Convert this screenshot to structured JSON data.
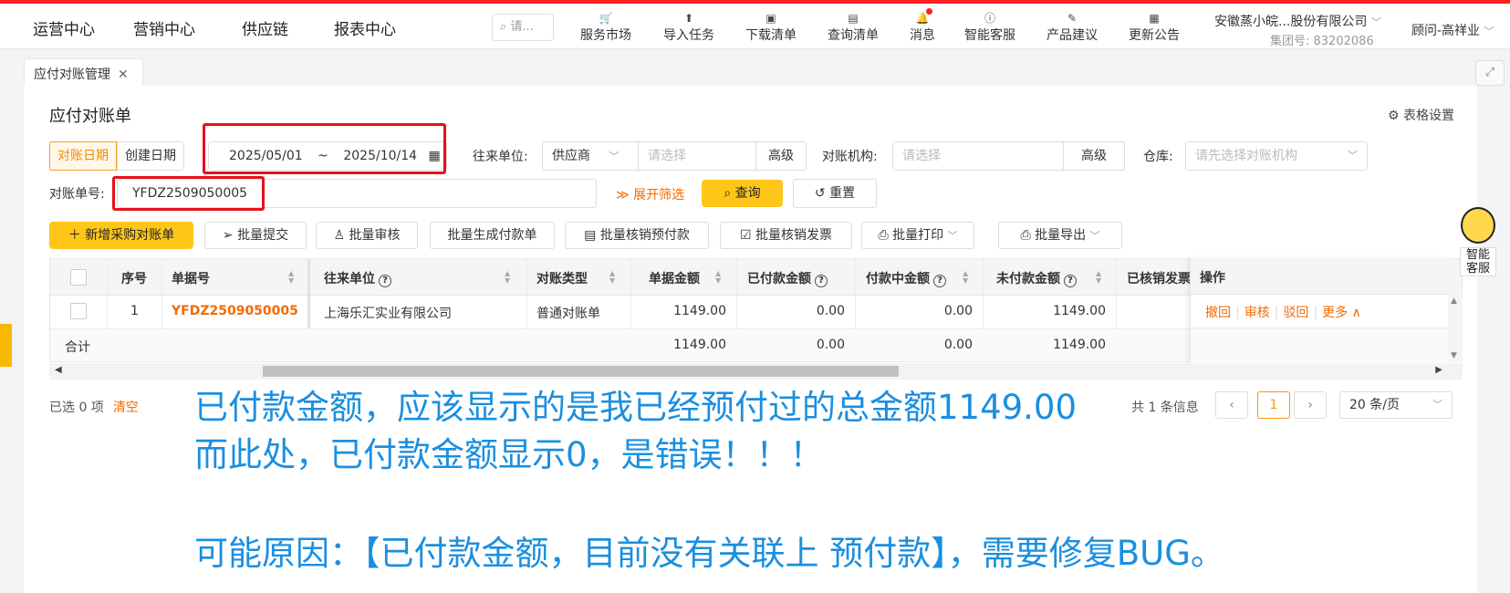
{
  "nav": {
    "items": [
      "运营中心",
      "营销中心",
      "供应链",
      "报表中心"
    ],
    "active_index": 2,
    "search_placeholder": "请...",
    "tools": [
      {
        "label": "服务市场",
        "icon": "cart-icon"
      },
      {
        "label": "导入任务",
        "icon": "import-icon"
      },
      {
        "label": "下载清单",
        "icon": "download-list-icon"
      },
      {
        "label": "查询清单",
        "icon": "query-list-icon"
      },
      {
        "label": "消息",
        "icon": "bell-icon"
      },
      {
        "label": "智能客服",
        "icon": "help-icon"
      },
      {
        "label": "产品建议",
        "icon": "suggestion-icon"
      },
      {
        "label": "更新公告",
        "icon": "announcement-icon"
      }
    ],
    "company": "安徽蒸小皖...股份有限公司",
    "group_no": "集团号: 83202086",
    "user": "顾问-高祥业"
  },
  "tab": {
    "label": "应付对账管理"
  },
  "page": {
    "title": "应付对账单",
    "table_settings": "表格设置"
  },
  "filters": {
    "date_mode": [
      "对账日期",
      "创建日期"
    ],
    "date_start": "2025/05/01",
    "date_sep": "~",
    "date_end": "2025/10/14",
    "partner_label": "往来单位:",
    "partner_type": "供应商",
    "partner_placeholder": "请选择",
    "advanced": "高级",
    "org_label": "对账机构:",
    "org_placeholder": "请选择",
    "warehouse_label": "仓库:",
    "warehouse_placeholder": "请先选择对账机构",
    "bill_no_label": "对账单号:",
    "bill_no_value": "YFDZ2509050005",
    "expand": "展开筛选",
    "query": "查询",
    "reset": "重置"
  },
  "actions": [
    "新增采购对账单",
    "批量提交",
    "批量审核",
    "批量生成付款单",
    "批量核销预付款",
    "批量核销发票",
    "批量打印",
    "批量导出"
  ],
  "table": {
    "headers": [
      "序号",
      "单据号",
      "往来单位",
      "对账类型",
      "单据金额",
      "已付款金额",
      "付款中金额",
      "未付款金额",
      "已核销发票",
      "操作"
    ],
    "rows": [
      {
        "seq": "1",
        "bill_no": "YFDZ2509050005",
        "partner": "上海乐汇实业有限公司",
        "type": "普通对账单",
        "amount": "1149.00",
        "paid": "0.00",
        "paying": "0.00",
        "unpaid": "1149.00"
      }
    ],
    "summary": {
      "label": "合计",
      "amount": "1149.00",
      "paid": "0.00",
      "paying": "0.00",
      "unpaid": "1149.00"
    },
    "row_actions": [
      "撤回",
      "审核",
      "驳回",
      "更多"
    ]
  },
  "footer": {
    "selected": "已选 0 项",
    "clear": "清空",
    "total": "共 1 条信息",
    "current_page": "1",
    "page_size": "20 条/页"
  },
  "annotation": {
    "line1": "已付款金额，应该显示的是我已经预付过的总金额1149.00",
    "line2": "而此处，已付款金额显示0，是错误！！！",
    "line3": "可能原因：【已付款金额，目前没有关联上 预付款】，需要修复BUG。"
  },
  "helper": {
    "label": "智能客服"
  },
  "colors": {
    "accent": "#ffc61a",
    "link": "#f36b00",
    "annotation": "#1a8fe0",
    "highlight": "#e8101a"
  }
}
